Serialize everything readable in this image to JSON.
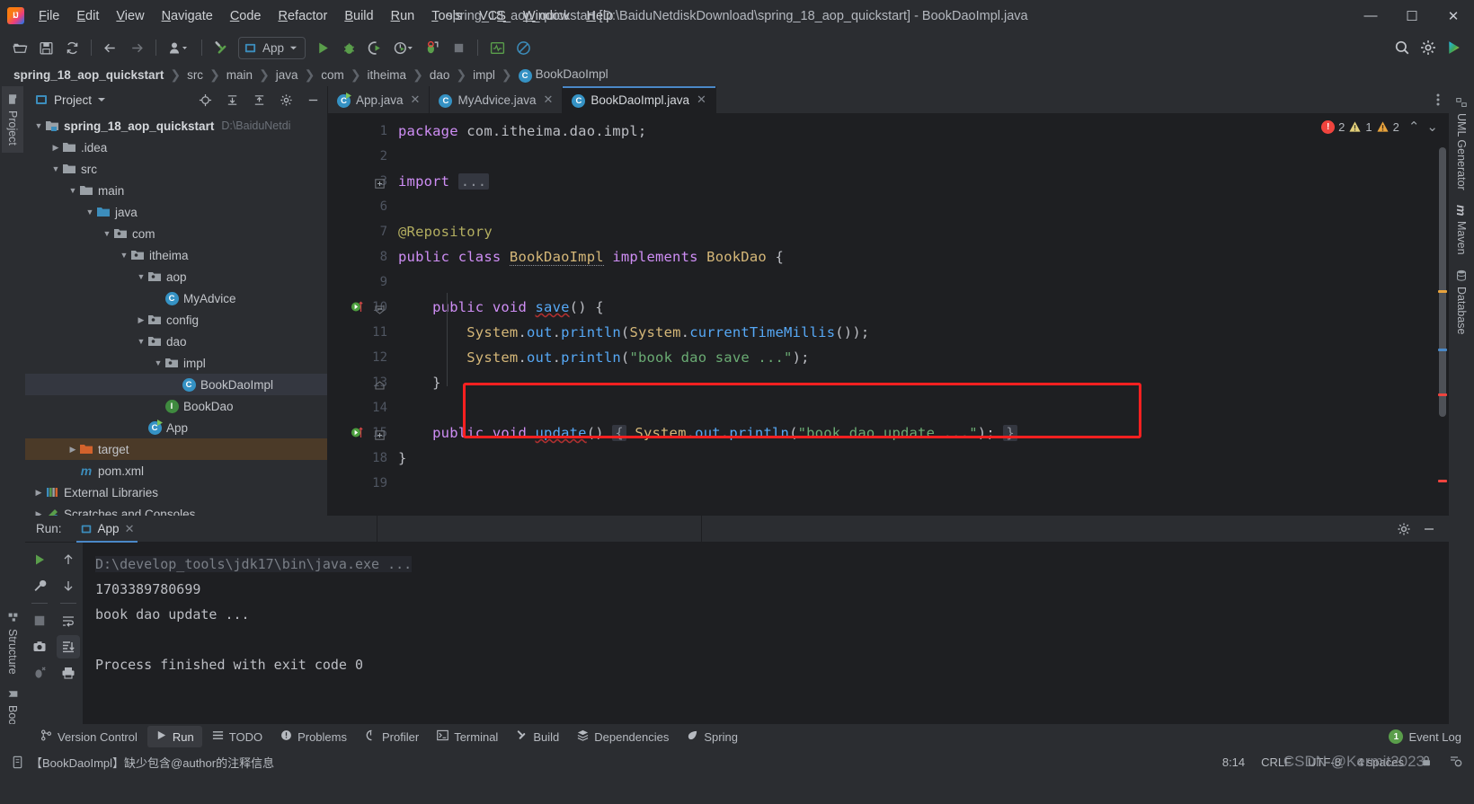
{
  "window": {
    "title": "spring_18_aop_quickstart [D:\\BaiduNetdiskDownload\\spring_18_aop_quickstart] - BookDaoImpl.java",
    "minimize": "—",
    "maximize": "☐",
    "close": "✕"
  },
  "menu": [
    "File",
    "Edit",
    "View",
    "Navigate",
    "Code",
    "Refactor",
    "Build",
    "Run",
    "Tools",
    "VCS",
    "Window",
    "Help"
  ],
  "toolbar": {
    "run_config": "App",
    "icons": [
      "open-folder-icon",
      "save-icon",
      "sync-icon",
      "back-arrow-icon",
      "forward-arrow-icon",
      "profile-icon",
      "build-hammer-icon",
      "run-icon",
      "debug-icon",
      "run-coverage-icon",
      "profiler-icon",
      "attach-debug-icon",
      "stop-icon",
      "monitor-icon",
      "no-entry-icon",
      "search-everywhere-icon",
      "settings-gear-icon",
      "updates-icon"
    ]
  },
  "breadcrumb": {
    "items": [
      "spring_18_aop_quickstart",
      "src",
      "main",
      "java",
      "com",
      "itheima",
      "dao",
      "impl"
    ],
    "last": "BookDaoImpl",
    "last_badge": "C"
  },
  "left_rail": {
    "project": "Project",
    "structure": "Structure",
    "bookmarks": "Bookmarks",
    "more": "»"
  },
  "right_rail": {
    "uml": "UML Generator",
    "maven": "Maven",
    "database": "Database",
    "maven_badge": "m"
  },
  "project": {
    "title": "Project",
    "tree": [
      {
        "depth": 0,
        "arrow": "down",
        "icon": "module-folder",
        "label": "spring_18_aop_quickstart",
        "bold": true,
        "path": "D:\\BaiduNetdi",
        "state": "normal"
      },
      {
        "depth": 1,
        "arrow": "right",
        "icon": "folder",
        "label": ".idea",
        "state": "normal"
      },
      {
        "depth": 1,
        "arrow": "down",
        "icon": "folder",
        "label": "src",
        "state": "normal"
      },
      {
        "depth": 2,
        "arrow": "down",
        "icon": "folder",
        "label": "main",
        "state": "normal"
      },
      {
        "depth": 3,
        "arrow": "down",
        "icon": "source-folder",
        "label": "java",
        "state": "normal"
      },
      {
        "depth": 4,
        "arrow": "down",
        "icon": "package",
        "label": "com",
        "state": "normal"
      },
      {
        "depth": 5,
        "arrow": "down",
        "icon": "package",
        "label": "itheima",
        "state": "normal"
      },
      {
        "depth": 6,
        "arrow": "down",
        "icon": "package",
        "label": "aop",
        "state": "normal"
      },
      {
        "depth": 7,
        "arrow": "none",
        "icon": "class",
        "label": "MyAdvice",
        "state": "normal"
      },
      {
        "depth": 6,
        "arrow": "right",
        "icon": "package",
        "label": "config",
        "state": "normal"
      },
      {
        "depth": 6,
        "arrow": "down",
        "icon": "package",
        "label": "dao",
        "state": "normal"
      },
      {
        "depth": 7,
        "arrow": "down",
        "icon": "package",
        "label": "impl",
        "state": "normal"
      },
      {
        "depth": 8,
        "arrow": "none",
        "icon": "class",
        "label": "BookDaoImpl",
        "state": "selected"
      },
      {
        "depth": 7,
        "arrow": "none",
        "icon": "interface",
        "label": "BookDao",
        "state": "normal"
      },
      {
        "depth": 6,
        "arrow": "none",
        "icon": "runnable-class",
        "label": "App",
        "state": "normal"
      },
      {
        "depth": 2,
        "arrow": "right",
        "icon": "target-folder",
        "label": "target",
        "state": "target"
      },
      {
        "depth": 2,
        "arrow": "none",
        "icon": "maven-file",
        "label": "pom.xml",
        "state": "normal"
      },
      {
        "depth": 0,
        "arrow": "right",
        "icon": "libraries",
        "label": "External Libraries",
        "state": "normal"
      },
      {
        "depth": 0,
        "arrow": "right",
        "icon": "scratches",
        "label": "Scratches and Consoles",
        "state": "normal"
      }
    ]
  },
  "editor": {
    "tabs": [
      {
        "label": "App.java",
        "icon": "runnable-class",
        "active": false
      },
      {
        "label": "MyAdvice.java",
        "icon": "class",
        "active": false
      },
      {
        "label": "BookDaoImpl.java",
        "icon": "class",
        "active": true
      }
    ],
    "line_numbers": [
      "1",
      "2",
      "3",
      "6",
      "7",
      "8",
      "9",
      "10",
      "11",
      "12",
      "13",
      "14",
      "15",
      "18",
      "19"
    ],
    "code_lines": [
      {
        "n": "1",
        "tokens": [
          {
            "t": "package ",
            "c": "kw"
          },
          {
            "t": "com.itheima.dao.impl;",
            "c": "pln"
          }
        ]
      },
      {
        "n": "2",
        "tokens": []
      },
      {
        "n": "3",
        "tokens": [
          {
            "t": "import ",
            "c": "kw"
          },
          {
            "t": "...",
            "c": "fold"
          }
        ]
      },
      {
        "n": "6",
        "tokens": []
      },
      {
        "n": "7",
        "tokens": [
          {
            "t": "@Repository",
            "c": "anno"
          }
        ]
      },
      {
        "n": "8",
        "tokens": [
          {
            "t": "public class ",
            "c": "kw"
          },
          {
            "t": "BookDaoImpl",
            "c": "cls squiggle-gray"
          },
          {
            "t": " implements ",
            "c": "kw"
          },
          {
            "t": "BookDao",
            "c": "cls"
          },
          {
            "t": " {",
            "c": "pln"
          }
        ]
      },
      {
        "n": "9",
        "tokens": []
      },
      {
        "n": "10",
        "tokens": [
          {
            "t": "    public void ",
            "c": "kw"
          },
          {
            "t": "save",
            "c": "fn squiggle"
          },
          {
            "t": "() {",
            "c": "pln"
          }
        ]
      },
      {
        "n": "11",
        "tokens": [
          {
            "t": "        ",
            "c": "pln"
          },
          {
            "t": "System",
            "c": "cls"
          },
          {
            "t": ".",
            "c": "pln"
          },
          {
            "t": "out",
            "c": "fn"
          },
          {
            "t": ".",
            "c": "pln"
          },
          {
            "t": "println",
            "c": "fn"
          },
          {
            "t": "(",
            "c": "pln"
          },
          {
            "t": "System",
            "c": "cls"
          },
          {
            "t": ".",
            "c": "pln"
          },
          {
            "t": "currentTimeMillis",
            "c": "fn"
          },
          {
            "t": "());",
            "c": "pln"
          }
        ]
      },
      {
        "n": "12",
        "tokens": [
          {
            "t": "        ",
            "c": "pln"
          },
          {
            "t": "System",
            "c": "cls"
          },
          {
            "t": ".",
            "c": "pln"
          },
          {
            "t": "out",
            "c": "fn"
          },
          {
            "t": ".",
            "c": "pln"
          },
          {
            "t": "println",
            "c": "fn"
          },
          {
            "t": "(",
            "c": "pln"
          },
          {
            "t": "\"book dao save ...\"",
            "c": "str"
          },
          {
            "t": ");",
            "c": "pln"
          }
        ]
      },
      {
        "n": "13",
        "tokens": [
          {
            "t": "    }",
            "c": "pln"
          }
        ]
      },
      {
        "n": "14",
        "tokens": []
      },
      {
        "n": "15",
        "tokens": [
          {
            "t": "    public void ",
            "c": "kw"
          },
          {
            "t": "update",
            "c": "fn squiggle"
          },
          {
            "t": "() ",
            "c": "pln"
          },
          {
            "t": "{",
            "c": "fold"
          },
          {
            "t": " ",
            "c": "pln"
          },
          {
            "t": "System",
            "c": "cls"
          },
          {
            "t": ".",
            "c": "pln"
          },
          {
            "t": "out",
            "c": "fn"
          },
          {
            "t": ".",
            "c": "pln"
          },
          {
            "t": "println",
            "c": "fn"
          },
          {
            "t": "(",
            "c": "pln"
          },
          {
            "t": "\"book dao update ...\"",
            "c": "str"
          },
          {
            "t": "); ",
            "c": "pln"
          },
          {
            "t": "}",
            "c": "fold"
          }
        ]
      },
      {
        "n": "18",
        "tokens": [
          {
            "t": "}",
            "c": "pln"
          }
        ]
      },
      {
        "n": "19",
        "tokens": []
      }
    ],
    "inspection": {
      "error_count": "2",
      "warning_count": "1",
      "weak_warning_count": "2",
      "prev": "⌃",
      "next": "⌄"
    }
  },
  "run_panel": {
    "label": "Run:",
    "tab": "App",
    "console": [
      {
        "text": "D:\\develop_tools\\jdk17\\bin\\java.exe ...",
        "dim": true
      },
      {
        "text": "1703389780699",
        "dim": false
      },
      {
        "text": "book dao update ...",
        "dim": false
      },
      {
        "text": "",
        "dim": false
      },
      {
        "text": "Process finished with exit code 0",
        "dim": false
      }
    ],
    "tools_left": [
      "rerun-icon",
      "settings-wrench-icon",
      "stop-icon",
      "screenshot-icon",
      "kill-process-icon"
    ],
    "tools_right": [
      "scroll-up-icon",
      "scroll-down-icon",
      "soft-wrap-icon",
      "scroll-to-end-icon",
      "print-icon"
    ]
  },
  "toolwindow_bar": [
    {
      "label": "Version Control",
      "icon": "branch-icon",
      "active": false
    },
    {
      "label": "Run",
      "icon": "run-icon",
      "active": true
    },
    {
      "label": "TODO",
      "icon": "todo-icon",
      "active": false
    },
    {
      "label": "Problems",
      "icon": "problems-icon",
      "active": false
    },
    {
      "label": "Profiler",
      "icon": "profiler-icon",
      "active": false
    },
    {
      "label": "Terminal",
      "icon": "terminal-icon",
      "active": false
    },
    {
      "label": "Build",
      "icon": "hammer-icon",
      "active": false
    },
    {
      "label": "Dependencies",
      "icon": "dependencies-icon",
      "active": false
    },
    {
      "label": "Spring",
      "icon": "spring-leaf-icon",
      "active": false
    }
  ],
  "event_log": {
    "count": "1",
    "label": "Event Log"
  },
  "status_bar": {
    "message": "【BookDaoImpl】缺少包含@author的注释信息",
    "caret": "8:14",
    "line_sep": "CRLF",
    "encoding": "UTF-8",
    "indent": "4 spaces"
  },
  "watermark": "CSDN @Kermit2023",
  "colors": {
    "bg_panel": "#2b2d31",
    "bg_editor": "#1e1f22",
    "accent_blue": "#4a88c7",
    "error_red": "#f0443e",
    "warn_orange": "#e8a33d",
    "highlight_red": "#ff2020",
    "selection": "#2e436e",
    "target_folder": "#4b3a28"
  }
}
